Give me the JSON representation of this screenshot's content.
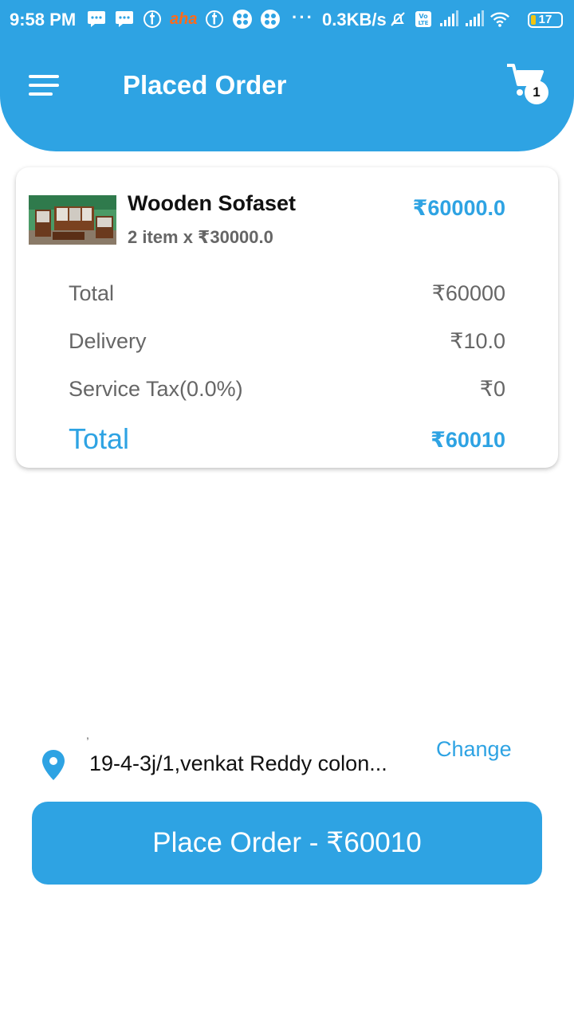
{
  "status_bar": {
    "time": "9:58 PM",
    "app_icon_text": "aha",
    "net_speed": "0.3KB/s",
    "battery": "17",
    "battery_level": 0.17
  },
  "header": {
    "title": "Placed Order",
    "cart_count": "1",
    "menu_icon": "menu-icon",
    "cart_icon": "cart-icon",
    "color": "#2ea3e3"
  },
  "order": {
    "product_name": "Wooden Sofaset",
    "product_price": "₹60000.0",
    "product_qty": "2 item x ₹30000.0",
    "rows": [
      {
        "label": "Total",
        "value": "₹60000"
      },
      {
        "label": "Delivery",
        "value": "₹10.0"
      },
      {
        "label": "Service Tax(0.0%)",
        "value": "₹0"
      }
    ],
    "grand_total_label": "Total",
    "grand_total_value": "₹60010"
  },
  "address": {
    "text": "19-4-3j/1,venkat Reddy colon...",
    "change_label": "Change"
  },
  "place_order_label": "Place Order - ₹60010"
}
